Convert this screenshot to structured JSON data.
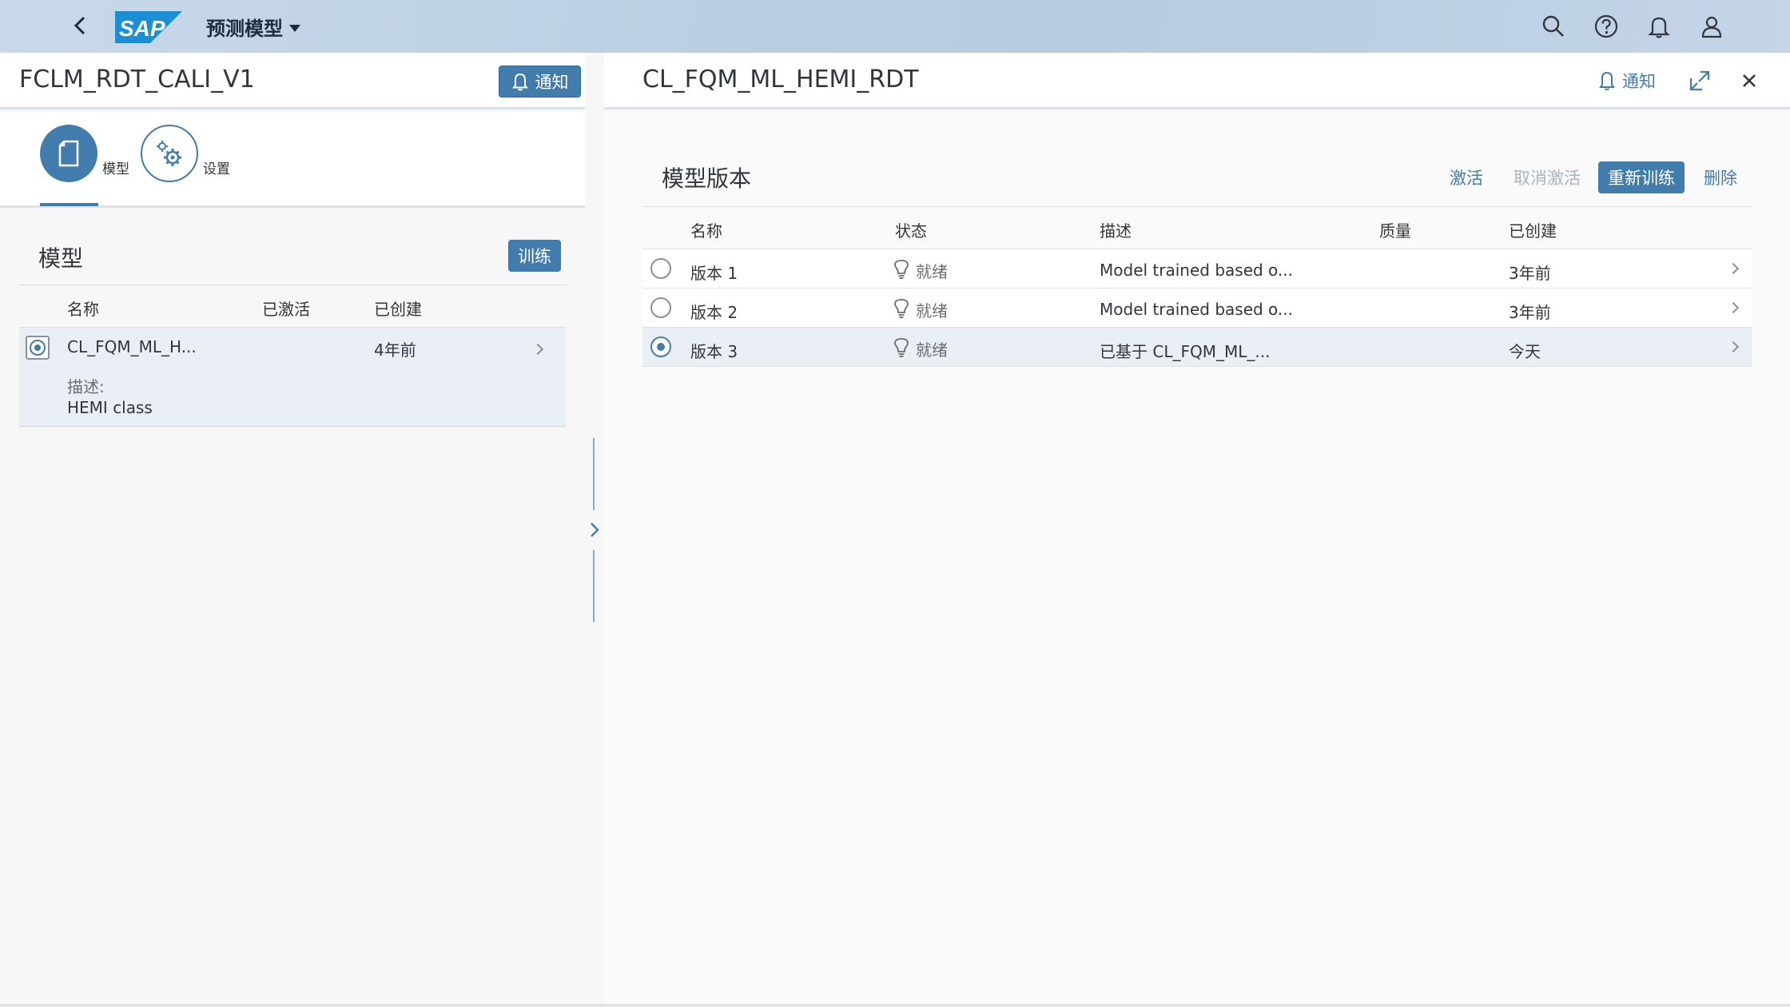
{
  "shell": {
    "app_title": "预测模型",
    "logo_text": "SAP",
    "icons": [
      "search-icon",
      "help-icon",
      "notification-bell-icon",
      "user-icon"
    ]
  },
  "left": {
    "title": "FCLM_RDT_CALI_V1",
    "notify_label": "通知",
    "tabs": [
      {
        "label": "模型",
        "icon": "document-icon",
        "active": true
      },
      {
        "label": "设置",
        "icon": "settings-gear-icon",
        "active": false
      }
    ],
    "section_title": "模型",
    "train_label": "训练",
    "table": {
      "columns": [
        "名称",
        "已激活",
        "已创建"
      ],
      "rows": [
        {
          "name": "CL_FQM_ML_H...",
          "activated": "",
          "created": "4年前",
          "desc_label": "描述:",
          "desc_value": "HEMI class",
          "selected": true
        }
      ]
    }
  },
  "right": {
    "title": "CL_FQM_ML_HEMI_RDT",
    "notify_label": "通知",
    "panel_title": "模型版本",
    "actions": {
      "activate": "激活",
      "deactivate": "取消激活",
      "retrain": "重新训练",
      "delete": "删除"
    },
    "table": {
      "columns": [
        "名称",
        "状态",
        "描述",
        "质量",
        "已创建"
      ],
      "rows": [
        {
          "name": "版本 1",
          "status": "就绪",
          "desc": "Model trained based o...",
          "quality": "",
          "created": "3年前",
          "selected": false
        },
        {
          "name": "版本 2",
          "status": "就绪",
          "desc": "Model trained based o...",
          "quality": "",
          "created": "3年前",
          "selected": false
        },
        {
          "name": "版本 3",
          "status": "就绪",
          "desc": "已基于 CL_FQM_ML_...",
          "quality": "",
          "created": "今天",
          "selected": true
        }
      ]
    }
  },
  "colors": {
    "accent": "#427cac",
    "shell_bg": "#c2d4e8",
    "selected_row": "#e9eff5"
  }
}
